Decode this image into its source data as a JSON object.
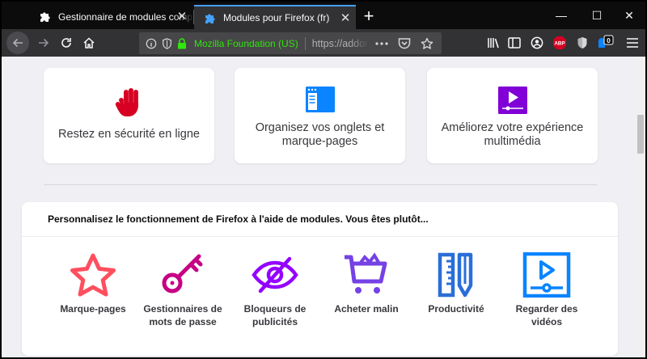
{
  "tabs": [
    {
      "title": "Gestionnaire de modules complémentaires",
      "icon": "puzzle-icon",
      "active": false
    },
    {
      "title": "Modules pour Firefox (fr)",
      "icon": "addons-icon",
      "active": true
    }
  ],
  "new_tab_symbol": "+",
  "window_controls": {
    "minimize": "—",
    "maximize": "☐",
    "close": "✕"
  },
  "urlbar": {
    "identity_org": "Mozilla Foundation (US)",
    "url": "https://addons.mozilla.org/fr/firefox/"
  },
  "toolbar": {
    "abp_badge": "ABP",
    "counter_badge": "0"
  },
  "feature_cards": [
    {
      "label": "Restez en sécurité en ligne",
      "icon": "stop-hand-icon"
    },
    {
      "label": "Organisez vos onglets et marque-pages",
      "icon": "browser-window-icon"
    },
    {
      "label": "Améliorez votre expérience multimédia",
      "icon": "video-player-icon"
    }
  ],
  "panel": {
    "title": "Personnalisez le fonctionnement de Firefox à l'aide de modules. Vous êtes plutôt...",
    "categories": [
      {
        "label": "Marque-pages",
        "icon": "star-icon"
      },
      {
        "label": "Gestionnaires de mots de passe",
        "icon": "key-icon"
      },
      {
        "label": "Bloqueurs de publicités",
        "icon": "blocked-eye-icon"
      },
      {
        "label": "Acheter malin",
        "icon": "shopping-cart-icon"
      },
      {
        "label": "Productivité",
        "icon": "ruler-pencil-icon"
      },
      {
        "label": "Regarder des vidéos",
        "icon": "video-icon"
      }
    ]
  },
  "colors": {
    "accent": "#45a1ff",
    "stop_red": "#d70022",
    "window_blue": "#0a84ff",
    "media_purple": "#8000d7",
    "star_red": "#ff4f5e",
    "key_magenta": "#c60084",
    "eye_purple": "#9400ff",
    "cart_violet": "#7542e5",
    "tools_blue": "#2a6ed8",
    "video_blue": "#0a84ff"
  }
}
